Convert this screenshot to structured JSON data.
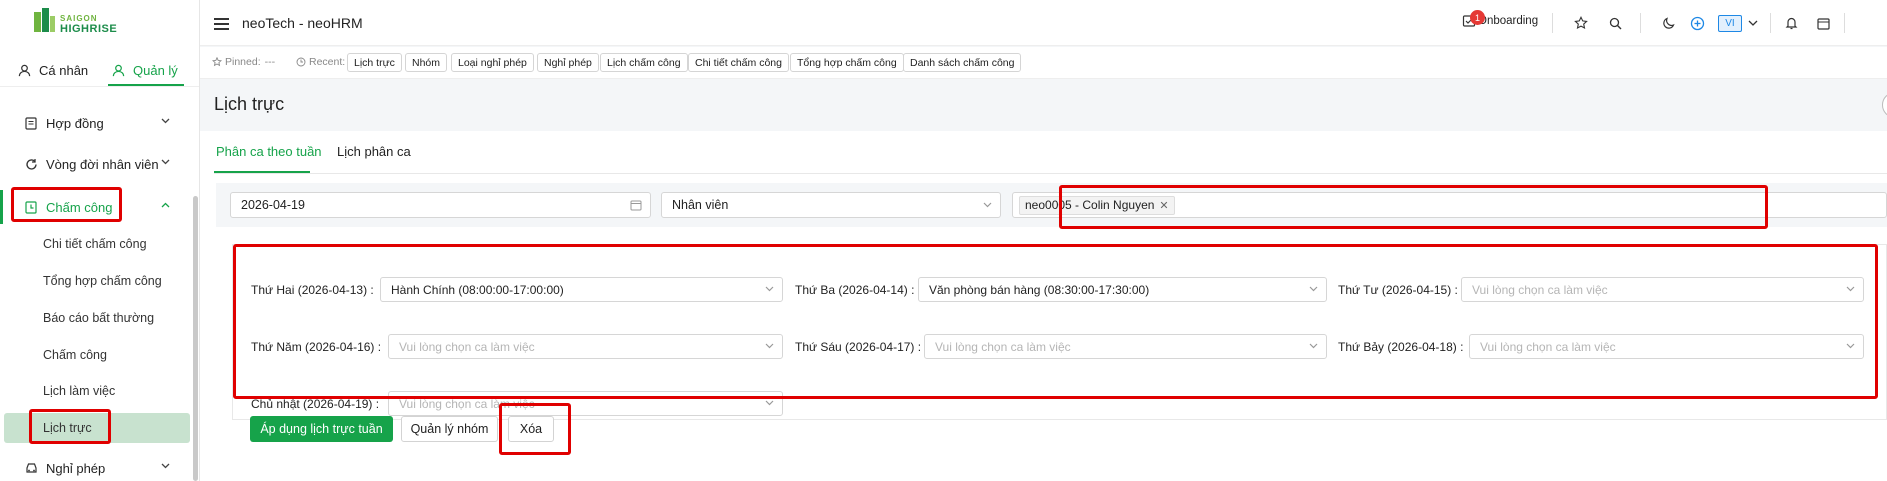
{
  "logo": {
    "line1": "SAIGON",
    "line2": "HIGHRISE"
  },
  "roles": {
    "personal": "Cá nhân",
    "manage": "Quản lý"
  },
  "sidebar": {
    "items": [
      {
        "label": "Hợp đồng"
      },
      {
        "label": "Vòng đời nhân viên"
      },
      {
        "label": "Chấm công"
      },
      {
        "label": "Nghỉ phép"
      }
    ],
    "sub_items": [
      {
        "label": "Chi tiết chấm công"
      },
      {
        "label": "Tổng hợp chấm công"
      },
      {
        "label": "Báo cáo bất thường"
      },
      {
        "label": "Chấm công"
      },
      {
        "label": "Lịch làm việc"
      },
      {
        "label": "Lịch trực"
      }
    ]
  },
  "header": {
    "title": "neoTech - neoHRM",
    "onboarding_label": "Onboarding",
    "onboarding_badge": "1",
    "language": "VI"
  },
  "pinned": {
    "pinned_label": "Pinned:",
    "pinned_value": "---",
    "recent_label": "Recent:",
    "recent": [
      "Lịch trực",
      "Nhóm",
      "Loại nghỉ phép",
      "Nghỉ phép",
      "Lịch chấm công",
      "Chi tiết chấm công",
      "Tổng hợp chấm công",
      "Danh sách chấm công"
    ]
  },
  "page": {
    "title": "Lịch trực"
  },
  "tabs": [
    {
      "label": "Phân ca theo tuần"
    },
    {
      "label": "Lịch phân ca"
    }
  ],
  "filters": {
    "date": "2026-04-19",
    "type": "Nhân viên",
    "employee_tag": "neo0005 - Colin Nguyen"
  },
  "shifts": {
    "placeholder": "Vui lòng chọn ca làm việc",
    "days": [
      {
        "label": "Thứ Hai (2026-04-13) :",
        "value": "Hành Chính (08:00:00-17:00:00)"
      },
      {
        "label": "Thứ Ba (2026-04-14) :",
        "value": "Văn phòng bán hàng (08:30:00-17:30:00)"
      },
      {
        "label": "Thứ Tư (2026-04-15) :",
        "value": ""
      },
      {
        "label": "Thứ Năm (2026-04-16) :",
        "value": ""
      },
      {
        "label": "Thứ Sáu (2026-04-17) :",
        "value": ""
      },
      {
        "label": "Thứ Bảy (2026-04-18) :",
        "value": ""
      },
      {
        "label": "Chủ nhật (2026-04-19) :",
        "value": ""
      }
    ]
  },
  "actions": {
    "apply": "Áp dụng lịch trực tuần",
    "manage_groups": "Quản lý nhóm",
    "delete": "Xóa"
  },
  "colors": {
    "accent": "#16a34a",
    "highlight": "#e00000",
    "selected_bg": "#c8e2cf"
  }
}
